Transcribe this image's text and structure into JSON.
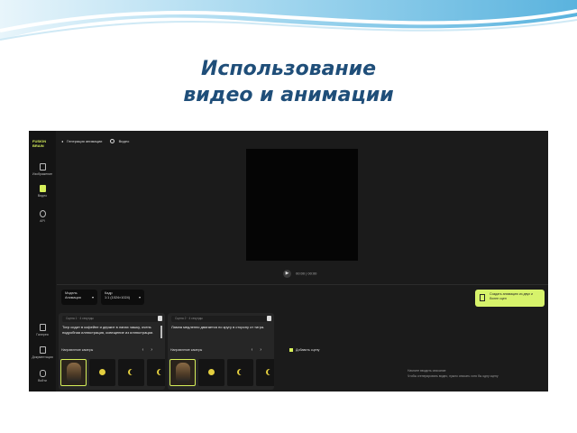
{
  "slide": {
    "title_line1": "Использование",
    "title_line2": "видео и анимации"
  },
  "app": {
    "logo_line1": "FUSION",
    "logo_line2": "BRAIN",
    "sidebar": [
      {
        "label": "Изображение",
        "icon": "image-icon",
        "active": false
      },
      {
        "label": "Видео",
        "icon": "video-icon",
        "active": true
      },
      {
        "label": "API",
        "icon": "api-icon",
        "active": false
      }
    ],
    "sidebar_bottom": [
      {
        "label": "Галерея",
        "icon": "gallery-icon"
      },
      {
        "label": "Документация",
        "icon": "docs-icon"
      },
      {
        "label": "Войти",
        "icon": "login-icon"
      }
    ],
    "topbar": {
      "back_label": "Генерация анимации",
      "radio_label": "Видео"
    },
    "player": {
      "time": "00:00 | 00:00"
    },
    "controls": {
      "model_label": "Модель",
      "model_value": "Анимация",
      "aspect_label": "Кадр",
      "aspect_value": "1:1 (1024×1024)",
      "helper_text": "Создать анимацию из двух и более сцен"
    },
    "scenes": [
      {
        "header": "Сцена 1 · 4 секунды",
        "text": "Тигр сидит в кофейне и держит в лапах чашку, очень подробная иллюстрация, освещение из иллюстрации.",
        "camera_label": "Направление камеры"
      },
      {
        "header": "Сцена 2 · 4 секунды",
        "text": "Лампа медленно двигается по кругу в сторону от тигра.",
        "camera_label": "Направление камеры"
      }
    ],
    "add_scene_label": "Добавить сцену",
    "notes_line1": "Начните вводить описание",
    "notes_line2": "Чтобы сгенерировать видео, нужно описать хотя бы одну сцену"
  },
  "colors": {
    "title": "#1f4e79",
    "accent": "#d6ef5a",
    "background": "#1b1b1b"
  }
}
